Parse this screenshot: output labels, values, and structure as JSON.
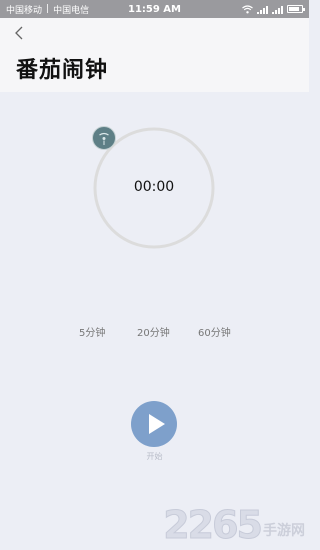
{
  "status_bar": {
    "carrier1": "中国移动",
    "carrier2": "中国电信",
    "time": "11:59 AM"
  },
  "header": {
    "title": "番茄闹钟"
  },
  "timer": {
    "display": "00:00",
    "progress": 0
  },
  "presets": [
    {
      "label": "5分钟"
    },
    {
      "label": "20分钟"
    },
    {
      "label": "60分钟"
    }
  ],
  "start": {
    "label": "开始"
  },
  "watermark": {
    "number": "2265",
    "suffix": "手游网"
  },
  "colors": {
    "accent": "#7ea0cb",
    "knob": "#5e7f86",
    "ring": "#dcdcdc"
  }
}
